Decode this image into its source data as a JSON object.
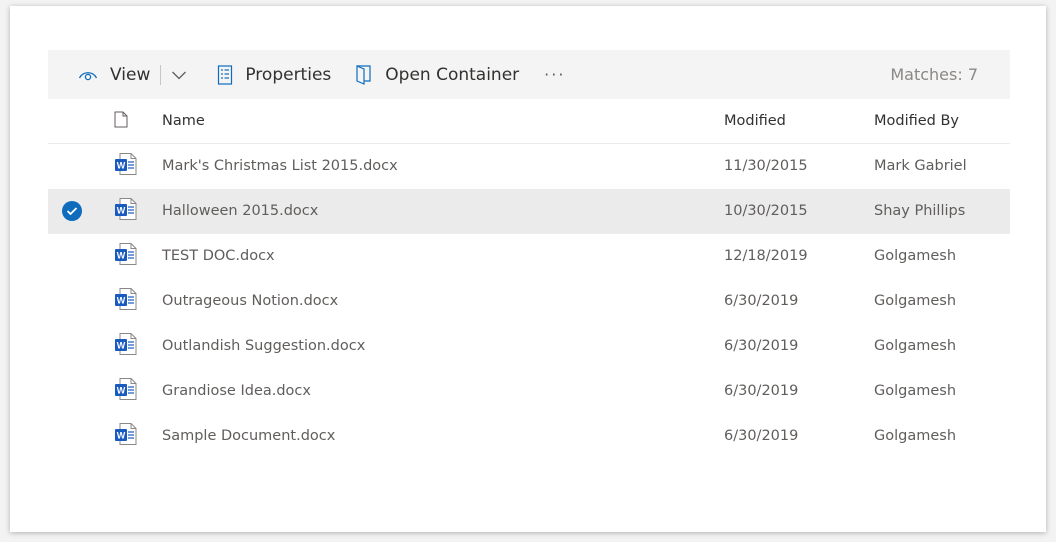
{
  "toolbar": {
    "view_label": "View",
    "view_icon": "eye-icon",
    "dropdown_icon": "chevron-down-icon",
    "properties_label": "Properties",
    "properties_icon": "properties-icon",
    "open_container_label": "Open Container",
    "open_container_icon": "open-container-icon",
    "more_label": "···",
    "matches_label": "Matches: 7"
  },
  "columns": {
    "file_type_icon": "document-icon",
    "name": "Name",
    "modified": "Modified",
    "modified_by": "Modified By"
  },
  "rows": [
    {
      "name": "Mark's Christmas List 2015.docx",
      "modified": "11/30/2015",
      "modified_by": "Mark Gabriel",
      "selected": false,
      "icon": "word-doc-icon"
    },
    {
      "name": "Halloween 2015.docx",
      "modified": "10/30/2015",
      "modified_by": "Shay Phillips",
      "selected": true,
      "icon": "word-doc-icon"
    },
    {
      "name": "TEST DOC.docx",
      "modified": "12/18/2019",
      "modified_by": "Golgamesh",
      "selected": false,
      "icon": "word-doc-icon"
    },
    {
      "name": "Outrageous Notion.docx",
      "modified": "6/30/2019",
      "modified_by": "Golgamesh",
      "selected": false,
      "icon": "word-doc-icon"
    },
    {
      "name": "Outlandish Suggestion.docx",
      "modified": "6/30/2019",
      "modified_by": "Golgamesh",
      "selected": false,
      "icon": "word-doc-icon"
    },
    {
      "name": "Grandiose Idea.docx",
      "modified": "6/30/2019",
      "modified_by": "Golgamesh",
      "selected": false,
      "icon": "word-doc-icon"
    },
    {
      "name": "Sample Document.docx",
      "modified": "6/30/2019",
      "modified_by": "Golgamesh",
      "selected": false,
      "icon": "word-doc-icon"
    }
  ],
  "colors": {
    "accent": "#0f6cbd",
    "word_blue": "#185abd",
    "selected_row": "#ebebeb",
    "toolbar_bg": "#f4f4f4"
  }
}
